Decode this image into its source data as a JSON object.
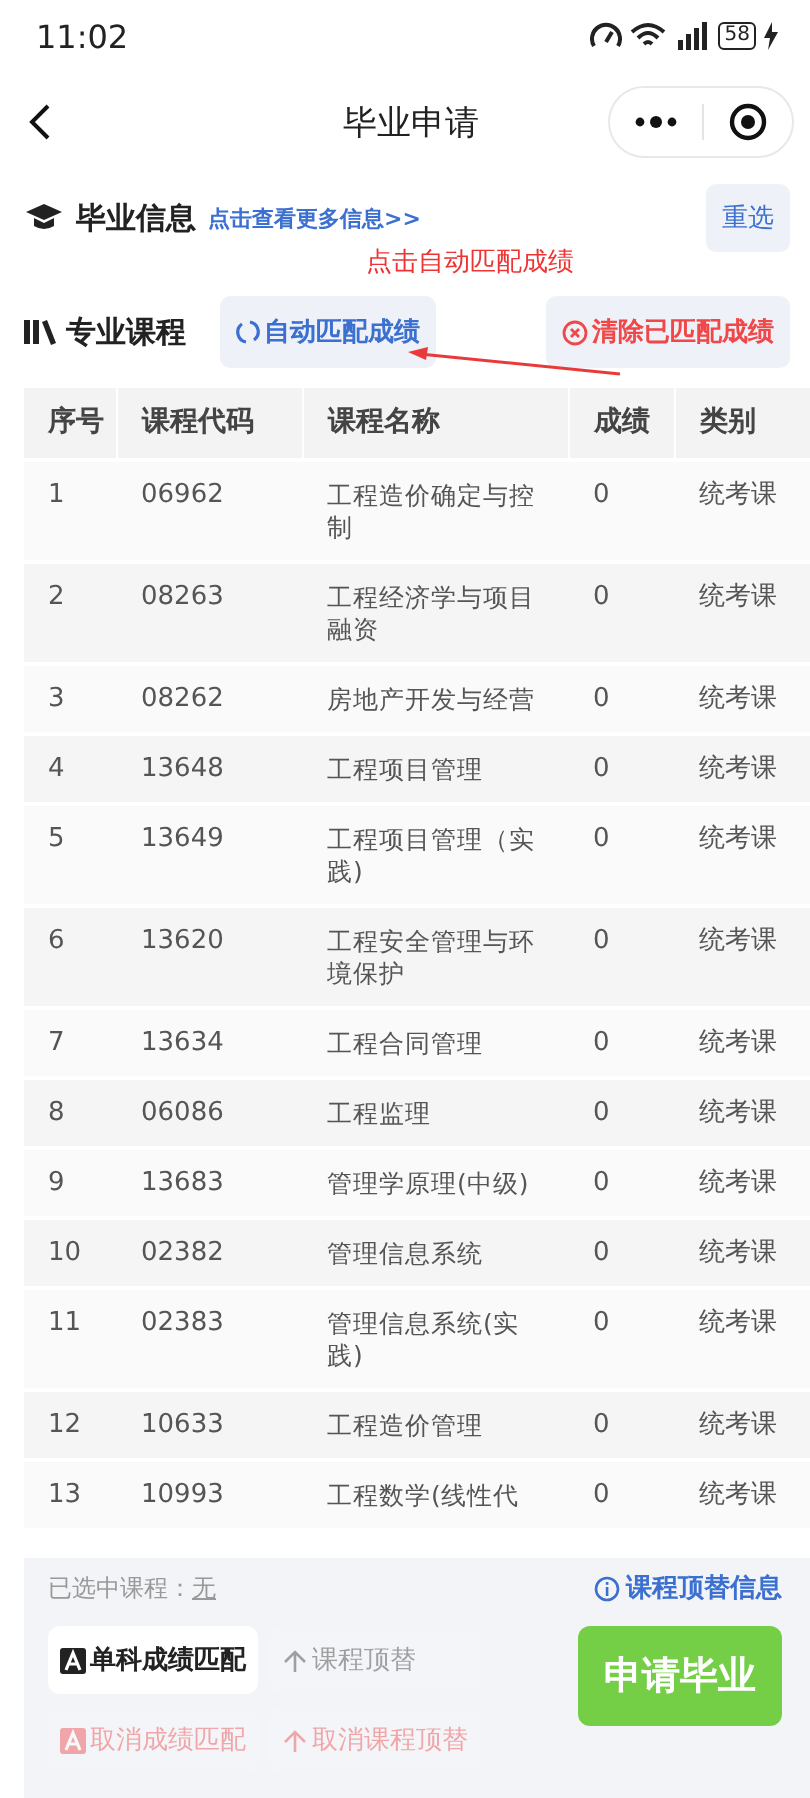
{
  "status_bar": {
    "time": "11:02",
    "battery": "58"
  },
  "nav": {
    "title": "毕业申请"
  },
  "grad_info": {
    "title": "毕业信息",
    "link": "点击查看更多信息>>",
    "reset_button": "重选"
  },
  "annotation": {
    "text": "点击自动匹配成绩"
  },
  "courses": {
    "title": "专业课程",
    "buttons": [
      {
        "label": "自动匹配成绩",
        "kind": "auto"
      },
      {
        "label": "清除已匹配成绩",
        "kind": "clear"
      }
    ]
  },
  "table": {
    "columns": [
      "序号",
      "课程代码",
      "课程名称",
      "成绩",
      "类别"
    ],
    "rows": [
      [
        "1",
        "06962",
        "工程造价确定与控制",
        "0",
        "统考课"
      ],
      [
        "2",
        "08263",
        "工程经济学与项目融资",
        "0",
        "统考课"
      ],
      [
        "3",
        "08262",
        "房地产开发与经营",
        "0",
        "统考课"
      ],
      [
        "4",
        "13648",
        "工程项目管理",
        "0",
        "统考课"
      ],
      [
        "5",
        "13649",
        "工程项目管理（实践)",
        "0",
        "统考课"
      ],
      [
        "6",
        "13620",
        "工程安全管理与环境保护",
        "0",
        "统考课"
      ],
      [
        "7",
        "13634",
        "工程合同管理",
        "0",
        "统考课"
      ],
      [
        "8",
        "06086",
        "工程监理",
        "0",
        "统考课"
      ],
      [
        "9",
        "13683",
        "管理学原理(中级)",
        "0",
        "统考课"
      ],
      [
        "10",
        "02382",
        "管理信息系统",
        "0",
        "统考课"
      ],
      [
        "11",
        "02383",
        "管理信息系统(实践)",
        "0",
        "统考课"
      ],
      [
        "12",
        "10633",
        "工程造价管理",
        "0",
        "统考课"
      ],
      [
        "13",
        "10993",
        "工程数学(线性代",
        "0",
        "统考课"
      ]
    ]
  },
  "footer": {
    "selected_label": "已选中课程：",
    "selected_value": "无",
    "info_link": "课程顶替信息",
    "actions": [
      {
        "label": "单科成绩匹配",
        "kind": "match",
        "disabled": false
      },
      {
        "label": "课程顶替",
        "kind": "replace",
        "disabled": true
      },
      {
        "label": "取消成绩匹配",
        "kind": "cancel_match",
        "disabled": true
      },
      {
        "label": "取消课程顶替",
        "kind": "cancel_replace",
        "disabled": true
      }
    ],
    "submit": "申请毕业"
  }
}
